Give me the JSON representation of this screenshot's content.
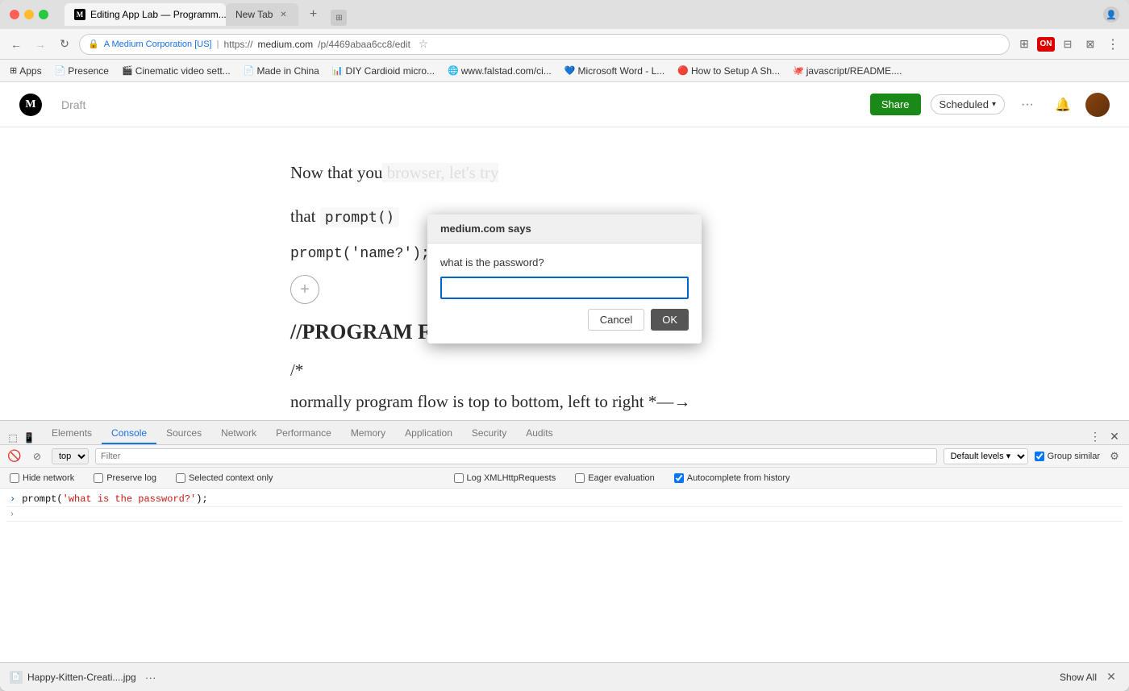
{
  "browser": {
    "traffic_lights": [
      "close",
      "minimize",
      "maximize"
    ],
    "tabs": [
      {
        "id": "tab1",
        "label": "Editing App Lab — Programm...",
        "active": true,
        "icon": "M"
      },
      {
        "id": "tab2",
        "label": "New Tab",
        "active": false,
        "icon": ""
      }
    ],
    "nav": {
      "back_disabled": false,
      "forward_disabled": true,
      "secure_label": "A Medium Corporation [US]",
      "url_protocol": "https://",
      "url_host": "medium.com",
      "url_path": "/p/4469abaa6cc8/edit"
    },
    "bookmarks": [
      {
        "label": "Apps",
        "icon": "⊞"
      },
      {
        "label": "Presence",
        "icon": "📄"
      },
      {
        "label": "Cinematic video sett...",
        "icon": "🎬"
      },
      {
        "label": "Made in China",
        "icon": "📄"
      },
      {
        "label": "DIY Cardioid micro...",
        "icon": "📊"
      },
      {
        "label": "www.falstad.com/ci...",
        "icon": "🌐"
      },
      {
        "label": "Microsoft Word - L...",
        "icon": "💙"
      },
      {
        "label": "How to Setup A Sh...",
        "icon": "🔴"
      },
      {
        "label": "javascript/README....",
        "icon": "🐙"
      }
    ]
  },
  "medium": {
    "logo": "M",
    "draft_label": "Draft",
    "share_label": "Share",
    "scheduled_label": "Scheduled",
    "more_icon": "···"
  },
  "dialog": {
    "title": "medium.com says",
    "prompt": "what is the password?",
    "input_value": "",
    "cancel_label": "Cancel",
    "ok_label": "OK"
  },
  "content": {
    "paragraph": "Now that you",
    "paragraph_cont": "owser, let's try",
    "paragraph2": "that prompt()",
    "code1": "prompt('name?');",
    "add_block": "+",
    "heading": "//PROGRAM FLOW",
    "comment_open": "/*",
    "program_flow": "normally program flow is top to bottom, left to right *—→"
  },
  "devtools": {
    "tabs": [
      {
        "label": "Elements",
        "active": false
      },
      {
        "label": "Console",
        "active": true
      },
      {
        "label": "Sources",
        "active": false
      },
      {
        "label": "Network",
        "active": false
      },
      {
        "label": "Performance",
        "active": false
      },
      {
        "label": "Memory",
        "active": false
      },
      {
        "label": "Application",
        "active": false
      },
      {
        "label": "Security",
        "active": false
      },
      {
        "label": "Audits",
        "active": false
      }
    ],
    "toolbar": {
      "context": "top",
      "filter_placeholder": "Filter",
      "levels_label": "Default levels",
      "group_similar_label": "Group similar"
    },
    "options": {
      "hide_network": "Hide network",
      "preserve_log": "Preserve log",
      "selected_context": "Selected context only",
      "log_xmlhttp": "Log XMLHttpRequests",
      "eager_eval": "Eager evaluation",
      "autocomplete": "Autocomplete from history"
    },
    "console_output": [
      {
        "type": "input",
        "text": "prompt('what is the password?');"
      },
      {
        "type": "chevron",
        "text": ">"
      }
    ]
  },
  "bottom_bar": {
    "download_label": "Happy-Kitten-Creati....jpg",
    "more_label": "···",
    "show_all_label": "Show All"
  }
}
